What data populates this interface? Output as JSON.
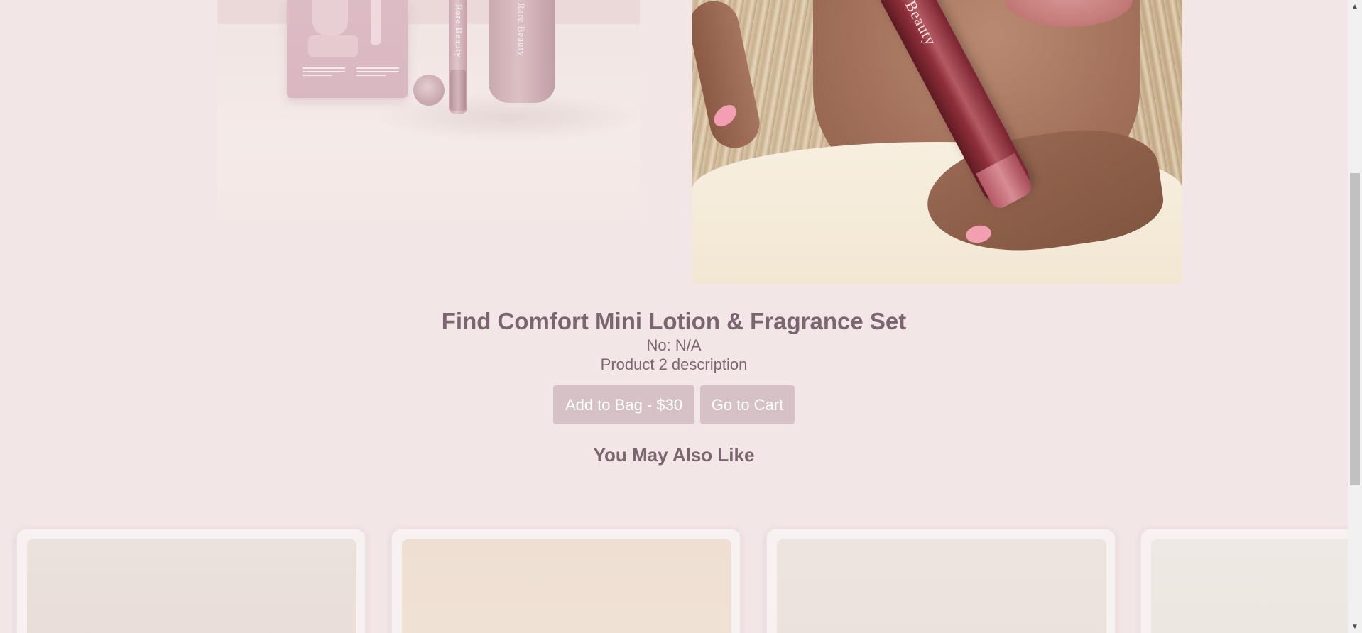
{
  "product": {
    "title": "Find Comfort Mini Lotion & Fragrance Set",
    "number": "No: N/A",
    "description": "Product 2 description",
    "add_to_bag_label": "Add to Bag - $30",
    "go_to_cart_label": "Go to Cart"
  },
  "images": {
    "left_brand_1": "Rare Beauty",
    "left_brand_2": "Rare Beauty",
    "right_brand": "Rare Beauty"
  },
  "recommendations": {
    "heading": "You May Also Like",
    "cards": [
      {
        "bg": "#ebe2dc"
      },
      {
        "bg": "#f0e0d4"
      },
      {
        "bg": "#ede4df"
      },
      {
        "bg": "#eee9e4"
      }
    ]
  },
  "colors": {
    "page_bg": "#f3e6e6",
    "text": "#7a6570",
    "button_bg": "#d6c2c6",
    "button_text": "#ffffff"
  },
  "scrollbar": {
    "up_icon": "▲",
    "down_icon": "▼"
  }
}
